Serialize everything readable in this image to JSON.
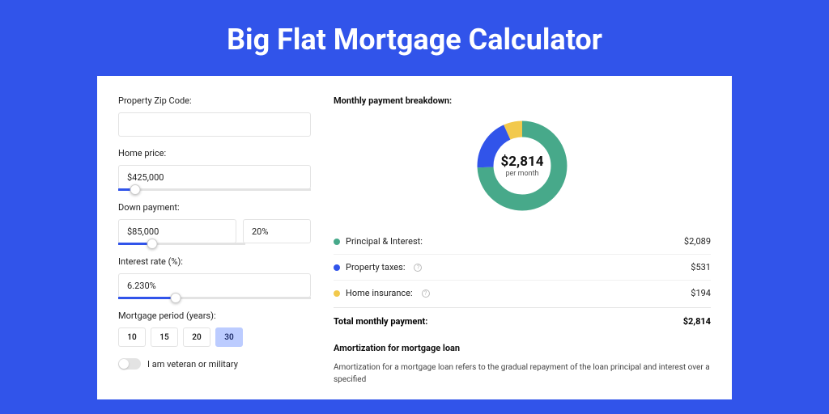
{
  "header": {
    "title": "Big Flat Mortgage Calculator"
  },
  "form": {
    "zip": {
      "label": "Property Zip Code:",
      "value": ""
    },
    "home_price": {
      "label": "Home price:",
      "value": "$425,000",
      "slider_pct": 9
    },
    "down_payment": {
      "label": "Down payment:",
      "value": "$85,000",
      "pct_value": "20%",
      "slider_pct": 18
    },
    "interest_rate": {
      "label": "Interest rate (%):",
      "value": "6.230%",
      "slider_pct": 30
    },
    "period": {
      "label": "Mortgage period (years):",
      "options": [
        "10",
        "15",
        "20",
        "30"
      ],
      "selected": "30"
    },
    "veteran": {
      "label": "I am veteran or military",
      "on": false
    }
  },
  "breakdown": {
    "title": "Monthly payment breakdown:",
    "center_value": "$2,814",
    "center_label": "per month",
    "items": [
      {
        "label": "Principal & Interest:",
        "value": "$2,089",
        "color": "green"
      },
      {
        "label": "Property taxes:",
        "value": "$531",
        "color": "blue",
        "help": true
      },
      {
        "label": "Home insurance:",
        "value": "$194",
        "color": "yellow",
        "help": true
      }
    ],
    "total_label": "Total monthly payment:",
    "total_value": "$2,814"
  },
  "amortization": {
    "title": "Amortization for mortgage loan",
    "text": "Amortization for a mortgage loan refers to the gradual repayment of the loan principal and interest over a specified"
  },
  "chart_data": {
    "type": "pie",
    "title": "Monthly payment breakdown",
    "categories": [
      "Principal & Interest",
      "Property taxes",
      "Home insurance"
    ],
    "values": [
      2089,
      531,
      194
    ],
    "colors": [
      "#47a98a",
      "#3154ea",
      "#f2c94c"
    ]
  }
}
